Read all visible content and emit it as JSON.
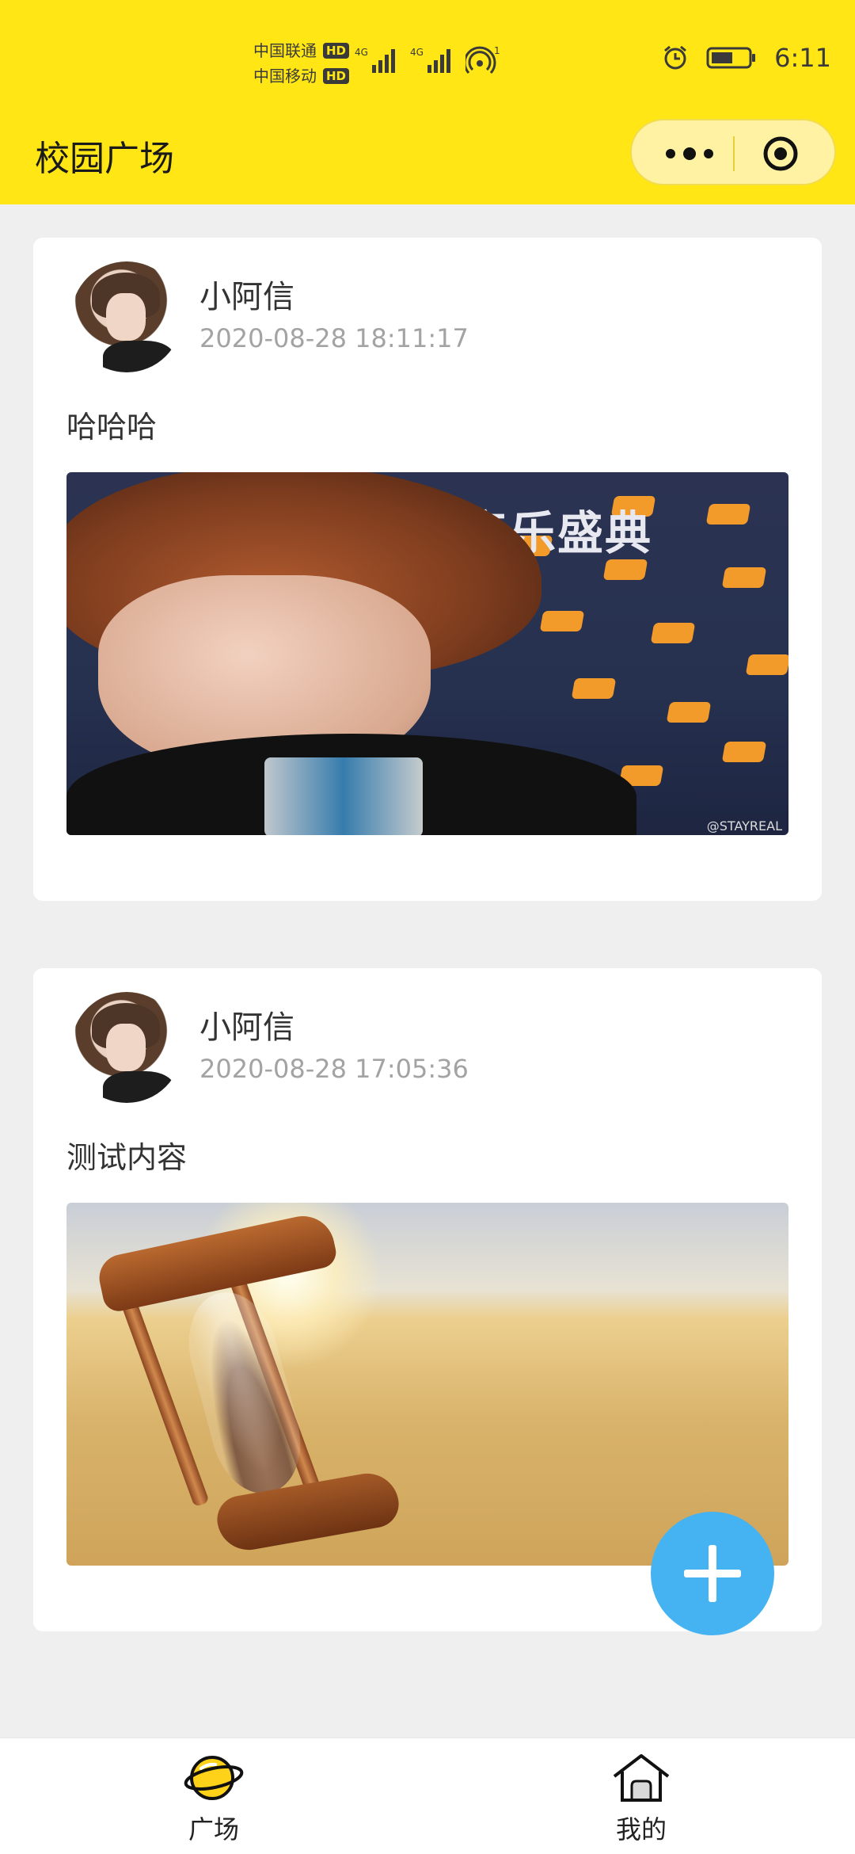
{
  "status_bar": {
    "carrier_1": "中国联通",
    "carrier_2": "中国移动",
    "hd_badge": "HD",
    "network_1": "4G",
    "network_2": "4G",
    "hotspot_count": "1",
    "time": "6:11"
  },
  "header": {
    "title": "校园广场",
    "capsule_more_icon": "ellipsis-icon",
    "capsule_close_icon": "target-close-icon",
    "background_color": "#ffe614"
  },
  "posts": [
    {
      "username": "小阿信",
      "timestamp": "2020-08-28 18:11:17",
      "content": "哈哈哈",
      "image_banner_text": "音乐盛典",
      "image_watermark": "@STAYREAL"
    },
    {
      "username": "小阿信",
      "timestamp": "2020-08-28 17:05:36",
      "content": "测试内容"
    }
  ],
  "fab": {
    "icon": "plus-icon",
    "color": "#45b3f1"
  },
  "tabbar": {
    "items": [
      {
        "label": "广场",
        "icon": "planet-icon"
      },
      {
        "label": "我的",
        "icon": "home-icon"
      }
    ]
  }
}
